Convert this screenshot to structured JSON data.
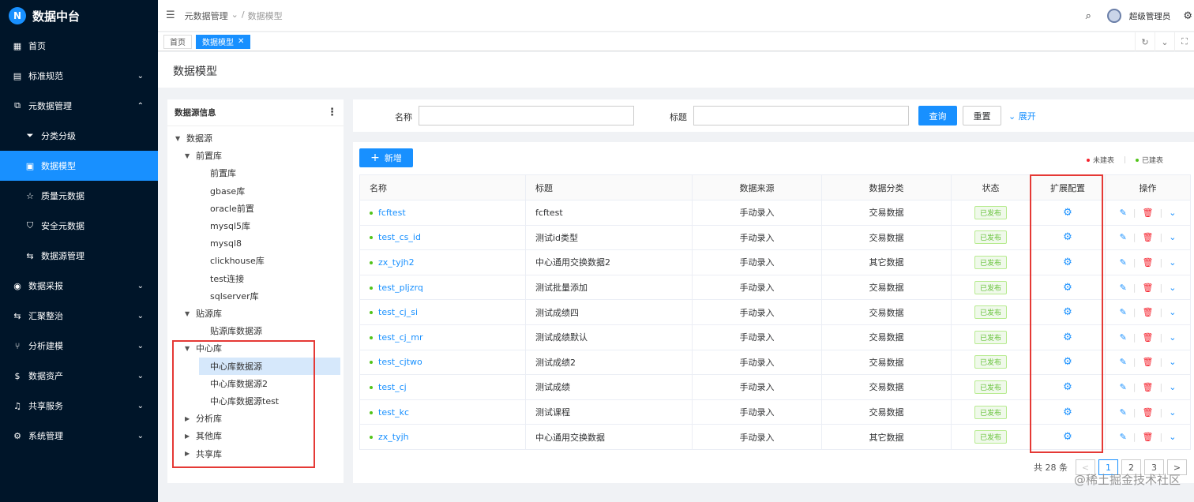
{
  "app": {
    "logo_letter": "N",
    "title": "数据中台"
  },
  "sidebar": {
    "items": [
      {
        "label": "首页",
        "icon": "grid-icon",
        "glyph": "▦",
        "arrow": ""
      },
      {
        "label": "标准规范",
        "icon": "document-icon",
        "glyph": "▤",
        "arrow": "⌄"
      },
      {
        "label": "元数据管理",
        "icon": "copy-icon",
        "glyph": "⧉",
        "arrow": "⌃"
      },
      {
        "label": "分类分级",
        "icon": "filter-icon",
        "glyph": "⏷",
        "arrow": "",
        "sub": true
      },
      {
        "label": "数据模型",
        "icon": "model-icon",
        "glyph": "▣",
        "arrow": "",
        "sub": true,
        "active": true
      },
      {
        "label": "质量元数据",
        "icon": "star-icon",
        "glyph": "☆",
        "arrow": "",
        "sub": true
      },
      {
        "label": "安全元数据",
        "icon": "shield-icon",
        "glyph": "⛉",
        "arrow": "",
        "sub": true
      },
      {
        "label": "数据源管理",
        "icon": "swap-icon",
        "glyph": "⇆",
        "arrow": "",
        "sub": true
      },
      {
        "label": "数据采报",
        "icon": "eye-icon",
        "glyph": "◉",
        "arrow": "⌄"
      },
      {
        "label": "汇聚整治",
        "icon": "swap-icon",
        "glyph": "⇆",
        "arrow": "⌄"
      },
      {
        "label": "分析建模",
        "icon": "fork-icon",
        "glyph": "⑂",
        "arrow": "⌄"
      },
      {
        "label": "数据资产",
        "icon": "coin-icon",
        "glyph": "$",
        "arrow": "⌄"
      },
      {
        "label": "共享服务",
        "icon": "bell-icon",
        "glyph": "♫",
        "arrow": "⌄"
      },
      {
        "label": "系统管理",
        "icon": "settings-icon",
        "glyph": "⚙",
        "arrow": "⌄"
      }
    ]
  },
  "header": {
    "breadcrumb_parent": "元数据管理",
    "breadcrumb_sep": "/",
    "breadcrumb_current": "数据模型",
    "user_name": "超级管理员"
  },
  "tags": {
    "home": "首页",
    "active": "数据模型",
    "close": "✕"
  },
  "page_title": "数据模型",
  "tree": {
    "header": "数据源信息",
    "nodes": [
      {
        "label": "数据源",
        "level": 0,
        "caret": "▼"
      },
      {
        "label": "前置库",
        "level": 1,
        "caret": "▼"
      },
      {
        "label": "前置库",
        "level": 2,
        "caret": ""
      },
      {
        "label": "gbase库",
        "level": 2,
        "caret": ""
      },
      {
        "label": "oracle前置",
        "level": 2,
        "caret": ""
      },
      {
        "label": "mysql5库",
        "level": 2,
        "caret": ""
      },
      {
        "label": "mysql8",
        "level": 2,
        "caret": ""
      },
      {
        "label": "clickhouse库",
        "level": 2,
        "caret": ""
      },
      {
        "label": "test连接",
        "level": 2,
        "caret": ""
      },
      {
        "label": "sqlserver库",
        "level": 2,
        "caret": ""
      },
      {
        "label": "贴源库",
        "level": 1,
        "caret": "▼"
      },
      {
        "label": "贴源库数据源",
        "level": 2,
        "caret": ""
      },
      {
        "label": "中心库",
        "level": 1,
        "caret": "▼"
      },
      {
        "label": "中心库数据源",
        "level": 2,
        "caret": "",
        "selected": true
      },
      {
        "label": "中心库数据源2",
        "level": 2,
        "caret": ""
      },
      {
        "label": "中心库数据源test",
        "level": 2,
        "caret": ""
      },
      {
        "label": "分析库",
        "level": 1,
        "caret": "▶"
      },
      {
        "label": "其他库",
        "level": 1,
        "caret": "▶"
      },
      {
        "label": "共享库",
        "level": 1,
        "caret": "▶"
      }
    ]
  },
  "search": {
    "name_label": "名称",
    "name_value": "",
    "title_label": "标题",
    "title_value": "",
    "query_button": "查询",
    "reset_button": "重置",
    "expand_link": "展开"
  },
  "toolbar": {
    "add_button": "新增",
    "legend_unbuilt": "未建表",
    "legend_built": "已建表",
    "legend_unbuilt_color": "#f5222d",
    "legend_built_color": "#52c41a"
  },
  "table": {
    "columns": [
      "名称",
      "标题",
      "数据来源",
      "数据分类",
      "状态",
      "扩展配置",
      "操作"
    ],
    "rows": [
      {
        "name": "fcftest",
        "title": "fcftest",
        "source": "手动录入",
        "category": "交易数据",
        "status": "已发布"
      },
      {
        "name": "test_cs_id",
        "title": "测试id类型",
        "source": "手动录入",
        "category": "交易数据",
        "status": "已发布"
      },
      {
        "name": "zx_tyjh2",
        "title": "中心通用交换数据2",
        "source": "手动录入",
        "category": "其它数据",
        "status": "已发布"
      },
      {
        "name": "test_pljzrq",
        "title": "测试批量添加",
        "source": "手动录入",
        "category": "交易数据",
        "status": "已发布"
      },
      {
        "name": "test_cj_si",
        "title": "测试成绩四",
        "source": "手动录入",
        "category": "交易数据",
        "status": "已发布"
      },
      {
        "name": "test_cj_mr",
        "title": "测试成绩默认",
        "source": "手动录入",
        "category": "交易数据",
        "status": "已发布"
      },
      {
        "name": "test_cjtwo",
        "title": "测试成绩2",
        "source": "手动录入",
        "category": "交易数据",
        "status": "已发布"
      },
      {
        "name": "test_cj",
        "title": "测试成绩",
        "source": "手动录入",
        "category": "交易数据",
        "status": "已发布"
      },
      {
        "name": "test_kc",
        "title": "测试课程",
        "source": "手动录入",
        "category": "交易数据",
        "status": "已发布"
      },
      {
        "name": "zx_tyjh",
        "title": "中心通用交换数据",
        "source": "手动录入",
        "category": "其它数据",
        "status": "已发布"
      }
    ]
  },
  "pagination": {
    "total": "共 28 条",
    "prev": "<",
    "pages": [
      "1",
      "2",
      "3"
    ],
    "current": "1",
    "next": ">"
  },
  "watermark": "@稀土掘金技术社区"
}
